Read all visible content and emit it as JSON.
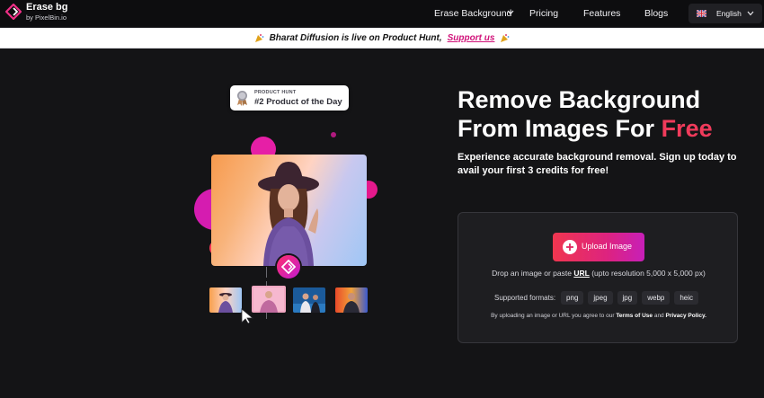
{
  "nav": {
    "logo_title": "Erase bg",
    "logo_subtitle": "by PixelBin.io",
    "items": [
      {
        "label": "Erase Background",
        "icon": "chevron-down-icon"
      },
      {
        "label": "Pricing"
      },
      {
        "label": "Features"
      },
      {
        "label": "Blogs"
      }
    ],
    "language": {
      "label": "English",
      "flag_icon": "uk-flag-icon",
      "icon": "chevron-down-icon"
    }
  },
  "banner": {
    "text": "Bharat Diffusion is live on Product Hunt,",
    "link": "Support us",
    "icon": "party-popper-icon"
  },
  "hero": {
    "badge_small": "PRODUCT HUNT",
    "badge_big": "#2 Product of the Day",
    "title_line1": "Remove Background",
    "title_line2_prefix": "From Images For",
    "title_highlight": "Free",
    "description": "Experience accurate background removal. Sign up today to avail your first 3 credits for free!"
  },
  "upload": {
    "button_label": "Upload Image",
    "drop_prefix": "Drop an image or paste",
    "drop_link": "URL",
    "drop_suffix": "(upto resolution 5,000 x 5,000 px)",
    "formats_label": "Supported formats:",
    "formats": [
      "png",
      "jpeg",
      "jpg",
      "webp",
      "heic"
    ],
    "terms_prefix": "By uploading an image or URL you agree to our",
    "terms_link": "Terms of Use",
    "terms_and": "and",
    "privacy_link": "Privacy Policy."
  },
  "colors": {
    "accent_pink": "#d1137a",
    "free_red": "#f03b5b",
    "background": "#141416"
  }
}
